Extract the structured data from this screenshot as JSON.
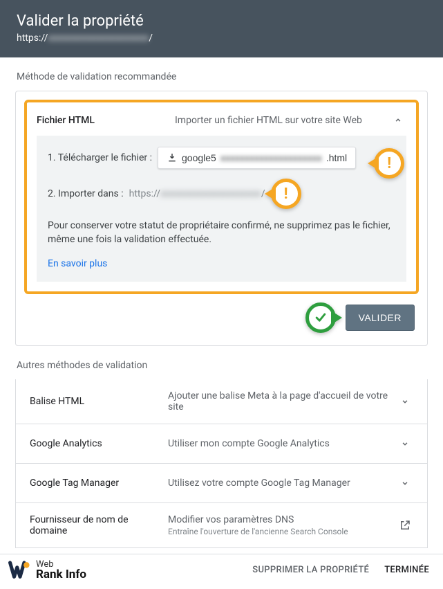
{
  "header": {
    "title": "Valider la propriété",
    "url_prefix": "https://",
    "url_blur": "xxxxxxxxxxxxxxxxxxxxx",
    "url_suffix": "/"
  },
  "recommended": {
    "section": "Méthode de validation recommandée",
    "title": "Fichier HTML",
    "desc": "Importer un fichier HTML sur votre site Web",
    "step1_label": "1. Télécharger le fichier :",
    "download_prefix": "google5",
    "download_blur": "xxxxxxxxxxxxxxxxxxxxx",
    "download_suffix": ".html",
    "step2_label": "2. Importer dans :",
    "step2_url_prefix": "https://",
    "step2_url_blur": "xxxxxxxxxxxxxxxxxxxxx",
    "step2_url_suffix": "/",
    "note": "Pour conserver votre statut de propriétaire confirmé, ne supprimez pas le fichier, même une fois la validation effectuée.",
    "learn_more": "En savoir plus",
    "validate": "VALIDER"
  },
  "other": {
    "section": "Autres méthodes de validation",
    "items": [
      {
        "title": "Balise HTML",
        "desc": "Ajouter une balise Meta à la page d'accueil de votre site",
        "icon": "chevron"
      },
      {
        "title": "Google Analytics",
        "desc": "Utiliser mon compte Google Analytics",
        "icon": "chevron"
      },
      {
        "title": "Google Tag Manager",
        "desc": "Utilisez votre compte Google Tag Manager",
        "icon": "chevron"
      },
      {
        "title": "Fournisseur de nom de domaine",
        "desc": "Modifier vos paramètres DNS",
        "sub": "Entraîne l'ouverture de l'ancienne Search Console",
        "icon": "external"
      }
    ]
  },
  "footer": {
    "brand1": "Web",
    "brand2": "Rank Info",
    "delete": "SUPPRIMER LA PROPRIÉTÉ",
    "done": "TERMINÉE"
  }
}
